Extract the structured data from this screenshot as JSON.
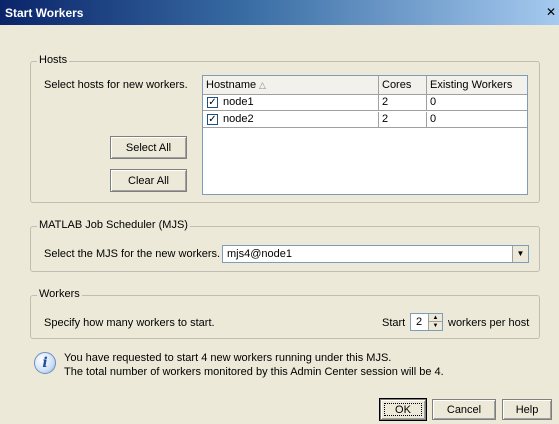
{
  "window": {
    "title": "Start Workers",
    "close_glyph": "✕"
  },
  "hosts": {
    "group_label": "Hosts",
    "instruction": "Select hosts for new workers.",
    "select_all_label": "Select All",
    "clear_all_label": "Clear All",
    "columns": [
      "Hostname",
      "Cores",
      "Existing Workers"
    ],
    "sort_indicator": "△",
    "rows": [
      {
        "checked": true,
        "hostname": "node1",
        "cores": "2",
        "existing": "0"
      },
      {
        "checked": true,
        "hostname": "node2",
        "cores": "2",
        "existing": "0"
      }
    ]
  },
  "mjs": {
    "group_label": "MATLAB Job Scheduler (MJS)",
    "instruction": "Select the MJS for the new workers.",
    "selected": "mjs4@node1"
  },
  "workers": {
    "group_label": "Workers",
    "instruction": "Specify how many workers to start.",
    "start_label": "Start",
    "count": "2",
    "per_host_label": "workers per host"
  },
  "info": {
    "line1": "You have requested to start 4 new workers running under this MJS.",
    "line2": "The total number of workers monitored by this Admin Center session will be 4."
  },
  "buttons": {
    "ok": "OK",
    "cancel": "Cancel",
    "help": "Help"
  }
}
